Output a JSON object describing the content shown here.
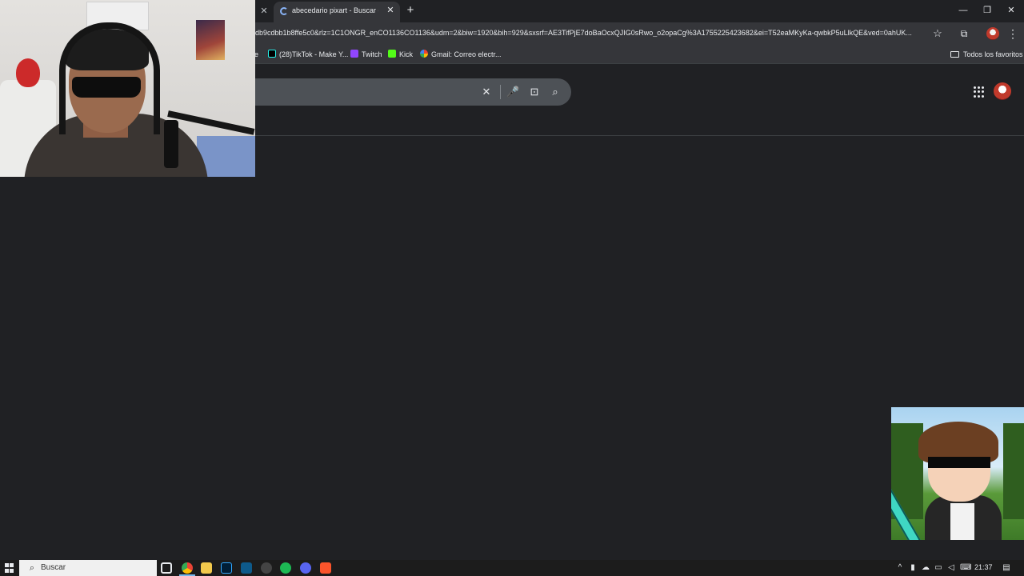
{
  "browser": {
    "tab": {
      "title": "abecedario pixart - Buscar con Google"
    },
    "address_bar": {
      "url": "db9cdbb1b8ffe5c0&rlz=1C1ONGR_enCO1136CO1136&udm=2&biw=1920&bih=929&sxsrf=AE3TifPjE7doBaOcxQJIG0sRwo_o2opaCg%3A1755225423682&ei=T52eaMKyKa-qwbkP5uLlkQE&ved=0ahUK..."
    },
    "bookmarks": [
      {
        "label": "e",
        "icon": "bookmark-icon"
      },
      {
        "label": "(28)TikTok - Make Y...",
        "icon": "tiktok-icon"
      },
      {
        "label": "Twitch",
        "icon": "twitch-icon"
      },
      {
        "label": "Kick",
        "icon": "kick-icon"
      },
      {
        "label": "Gmail: Correo electr...",
        "icon": "google-icon"
      }
    ],
    "favorites_folder": "Todos los favoritos"
  },
  "taskbar": {
    "search_label": "Buscar",
    "clock": "21:37"
  },
  "icons": {
    "tab_close": "✕",
    "new_tab": "+",
    "minimize": "—",
    "restore": "❐",
    "window_close": "✕",
    "star": "☆",
    "extensions": "⧉",
    "menu": "⋮",
    "clear": "✕",
    "voice": "🎤",
    "lens": "⊡",
    "search": "⌕"
  },
  "colors": {
    "page_bg": "#202124",
    "toolbar_bg": "#35363a",
    "search_box_bg": "#4d5156",
    "text": "#e8eaed"
  }
}
